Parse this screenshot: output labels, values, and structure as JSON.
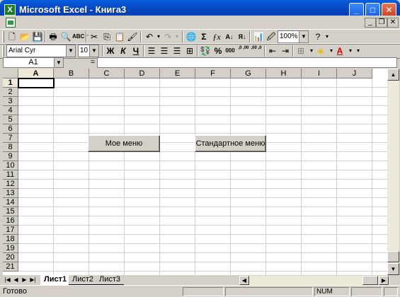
{
  "window": {
    "title": "Microsoft Excel - Книга3",
    "app_icon": "excel-icon",
    "controls": [
      "minimize",
      "maximize",
      "close"
    ]
  },
  "toolbar_standard": {
    "zoom": "100%",
    "icons": [
      "new-icon",
      "open-icon",
      "save-icon",
      "print-icon",
      "print-preview-icon",
      "spelling-icon",
      "cut-icon",
      "copy-icon",
      "paste-icon",
      "format-painter-icon",
      "undo-icon",
      "redo-icon",
      "hyperlink-icon",
      "autosum-icon",
      "function-icon",
      "sort-ascending-icon",
      "sort-descending-icon",
      "chart-wizard-icon",
      "drawing-icon",
      "help-icon"
    ]
  },
  "toolbar_formatting": {
    "font_name": "Arial Cyr",
    "font_size": "10",
    "bold": "Ж",
    "italic": "К",
    "underline": "Ч",
    "percent": "%",
    "thousands": "000",
    "inc_decimal": ",0 ,00",
    "dec_decimal": ",00 ,0"
  },
  "formula_bar": {
    "name_box": "A1",
    "equals": "=",
    "value": ""
  },
  "grid": {
    "columns": [
      "A",
      "B",
      "C",
      "D",
      "E",
      "F",
      "G",
      "H",
      "I",
      "J"
    ],
    "rows": [
      "1",
      "2",
      "3",
      "4",
      "5",
      "6",
      "7",
      "8",
      "9",
      "10",
      "11",
      "12",
      "13",
      "14",
      "15",
      "16",
      "17",
      "18",
      "19",
      "20",
      "21"
    ],
    "active_cell": "A1"
  },
  "buttons": {
    "my_menu": "Мое меню",
    "standard_menu": "Стандартное меню"
  },
  "sheets": {
    "tabs": [
      "Лист1",
      "Лист2",
      "Лист3"
    ],
    "active": "Лист1"
  },
  "status": {
    "text": "Готово",
    "num": "NUM"
  }
}
